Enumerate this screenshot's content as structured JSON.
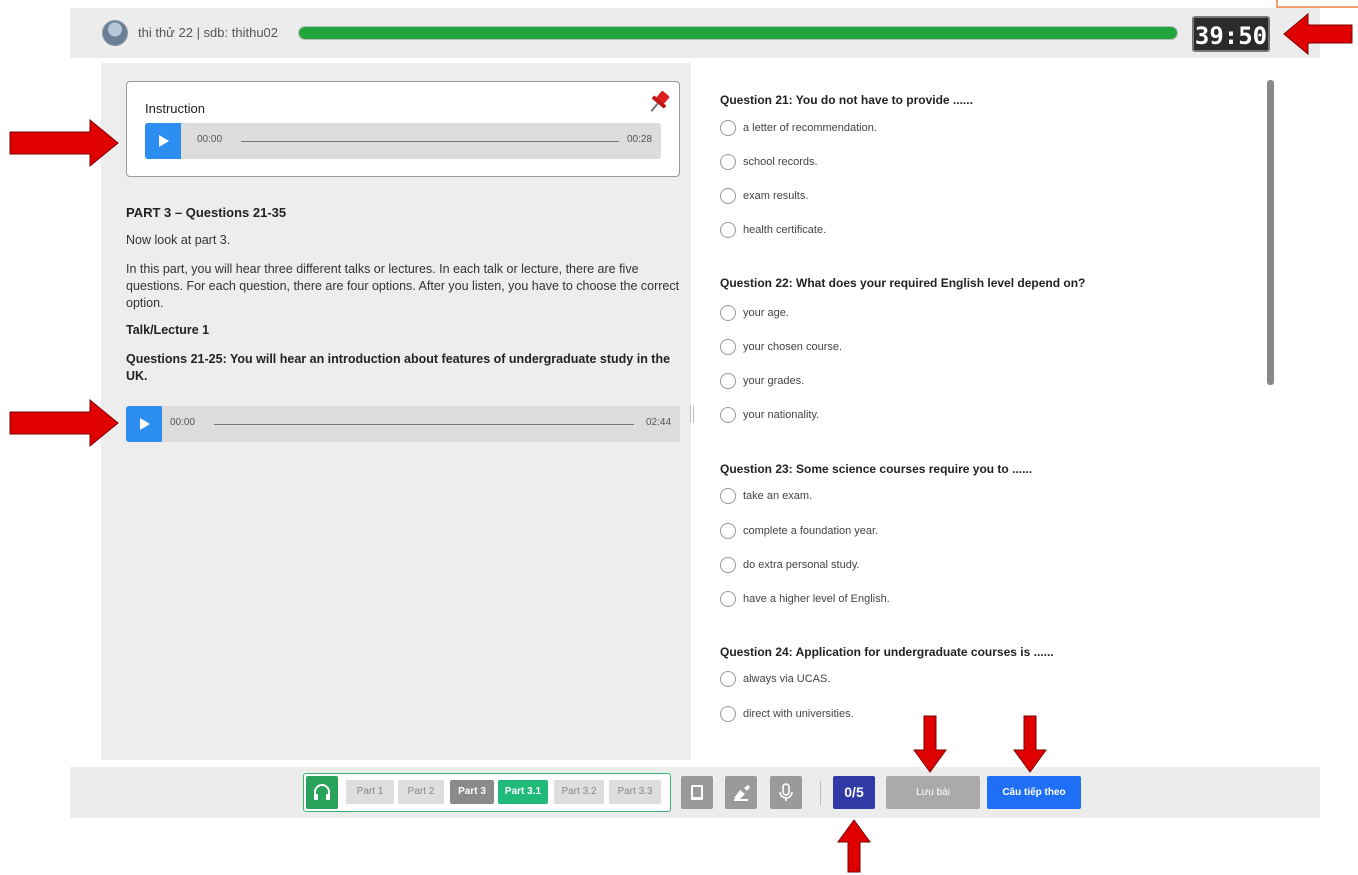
{
  "header": {
    "user_info": "thi thử 22  |  sdb: thithu02",
    "progress_fraction": 1.0,
    "timer": "39:50"
  },
  "instruction": {
    "title": "Instruction",
    "audio": {
      "current": "00:00",
      "duration": "00:28"
    }
  },
  "part": {
    "title": "PART 3 – Questions 21-35",
    "intro": "Now look at part 3.",
    "description": "In this part, you will hear three different talks or lectures. In each talk or lecture, there are five questions. For each question, there are four options. After you listen, you have to choose the correct option.",
    "talk_label": "Talk/Lecture 1",
    "questions_intro": "Questions 21-25: You will hear an introduction about features of undergraduate study in the UK.",
    "audio": {
      "current": "00:00",
      "duration": "02:44"
    }
  },
  "questions": [
    {
      "title": "Question 21: You do not have to provide ......",
      "options": [
        "a letter of recommendation.",
        "school records.",
        "exam results.",
        "health certificate."
      ]
    },
    {
      "title": "Question 22: What does your required English level depend on?",
      "options": [
        "your age.",
        "your chosen course.",
        "your grades.",
        "your nationality."
      ]
    },
    {
      "title": "Question 23: Some science courses require you to ......",
      "options": [
        "take an exam.",
        "complete a foundation year.",
        "do extra personal study.",
        "have a higher level of English."
      ]
    },
    {
      "title": "Question 24: Application for undergraduate courses is ......",
      "options": [
        "always via UCAS.",
        "direct with universities."
      ]
    }
  ],
  "footer": {
    "parts": [
      "Part 1",
      "Part 2",
      "Part 3",
      "Part 3.1",
      "Part 3.2",
      "Part 3.3"
    ],
    "score": "0/5",
    "save_label": "Lưu bài",
    "next_label": "Câu tiếp theo"
  },
  "colors": {
    "accent_blue": "#1e6ff5",
    "progress_green": "#22a53a",
    "active_part": "#1fba7a",
    "score_bg": "#2f3aa6",
    "arrow_red": "#e00000"
  }
}
